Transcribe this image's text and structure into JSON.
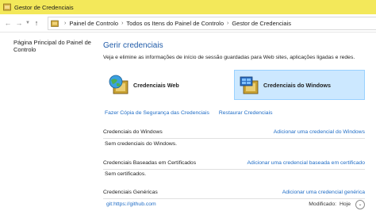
{
  "window": {
    "title": "Gestor de Credenciais"
  },
  "navbar": {
    "back_icon": "back-arrow-icon",
    "forward_icon": "forward-arrow-icon",
    "recent_icon": "chevron-down-icon",
    "up_icon": "up-arrow-icon",
    "breadcrumbs": [
      "Painel de Controlo",
      "Todos os Itens do Painel de Controlo",
      "Gestor de Credenciais"
    ]
  },
  "sidebar": {
    "home_link": "Página Principal do Painel de Controlo"
  },
  "main": {
    "heading": "Gerir credenciais",
    "description": "Veja e elimine as informações de início de sessão guardadas para Web sites, aplicações ligadas e redes.",
    "categories": [
      {
        "label": "Credenciais Web",
        "icon": "globe-vault-icon",
        "selected": false
      },
      {
        "label": "Credenciais do Windows",
        "icon": "windows-vault-icon",
        "selected": true
      }
    ],
    "actions": {
      "backup": "Fazer Cópia de Segurança das Credenciais",
      "restore": "Restaurar Credenciais"
    },
    "sections": [
      {
        "title": "Credenciais do Windows",
        "add_link": "Adicionar uma credencial do Windows",
        "empty_text": "Sem credenciais do Windows."
      },
      {
        "title": "Credenciais Baseadas em Certificados",
        "add_link": "Adicionar uma credencial baseada em certificado",
        "empty_text": "Sem certificados."
      },
      {
        "title": "Credenciais Genéricas",
        "add_link": "Adicionar uma credencial genérica"
      }
    ],
    "generic_items": [
      {
        "name": "git:https://github.com",
        "modified_label": "Modificado:",
        "modified_value": "Hoje"
      }
    ]
  },
  "colors": {
    "titlebar": "#f3e85a",
    "link": "#1e6cc6",
    "heading": "#1e5aa8",
    "selected_bg": "#cce8ff"
  }
}
